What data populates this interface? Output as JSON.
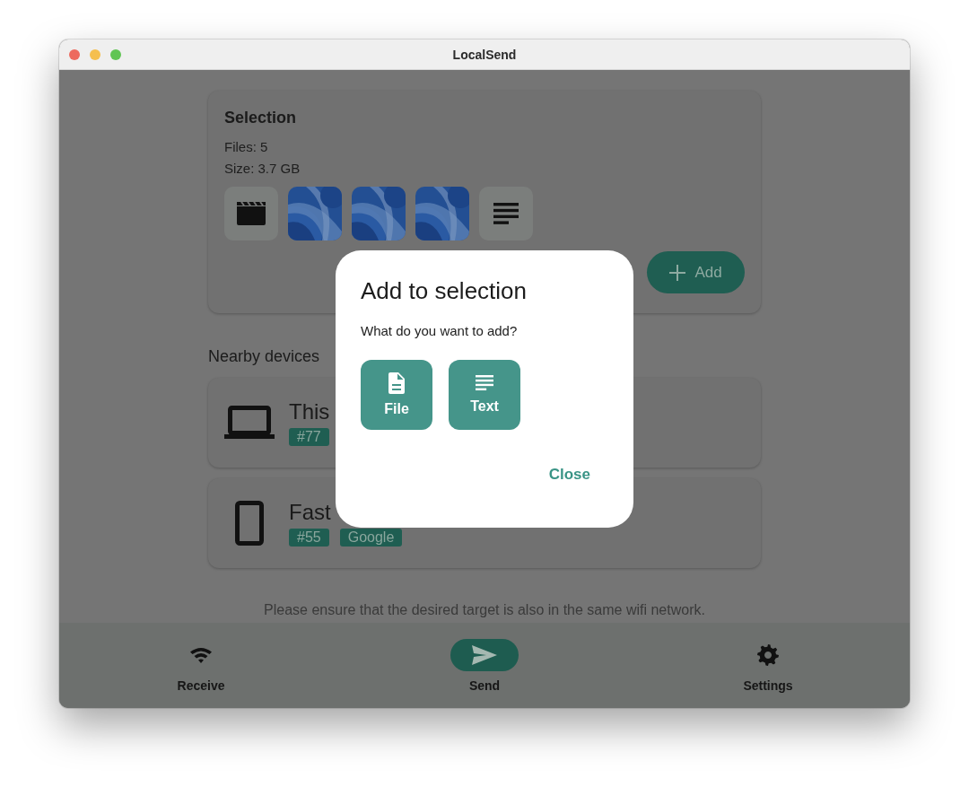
{
  "window": {
    "title": "LocalSend"
  },
  "selection": {
    "title": "Selection",
    "files": "Files: 5",
    "size": "Size: 3.7 GB",
    "thumbnails": [
      {
        "kind": "video"
      },
      {
        "kind": "picture"
      },
      {
        "kind": "picture"
      },
      {
        "kind": "picture"
      },
      {
        "kind": "text"
      }
    ],
    "add_button": "Add"
  },
  "nearby": {
    "title": "Nearby devices",
    "devices": [
      {
        "name": "This",
        "kind": "laptop",
        "badges": [
          "#77"
        ]
      },
      {
        "name": "Fast",
        "kind": "phone",
        "badges": [
          "#55",
          "Google"
        ]
      }
    ]
  },
  "hint": "Please ensure that the desired target is also in the same wifi network.",
  "nav": [
    {
      "label": "Receive",
      "kind": "wifi",
      "selected": false
    },
    {
      "label": "Send",
      "kind": "send",
      "selected": true
    },
    {
      "label": "Settings",
      "kind": "gear",
      "selected": false
    }
  ],
  "dialog": {
    "title": "Add to selection",
    "message": "What do you want to add?",
    "options": [
      {
        "label": "File",
        "kind": "file"
      },
      {
        "label": "Text",
        "kind": "text"
      }
    ],
    "close": "Close"
  }
}
